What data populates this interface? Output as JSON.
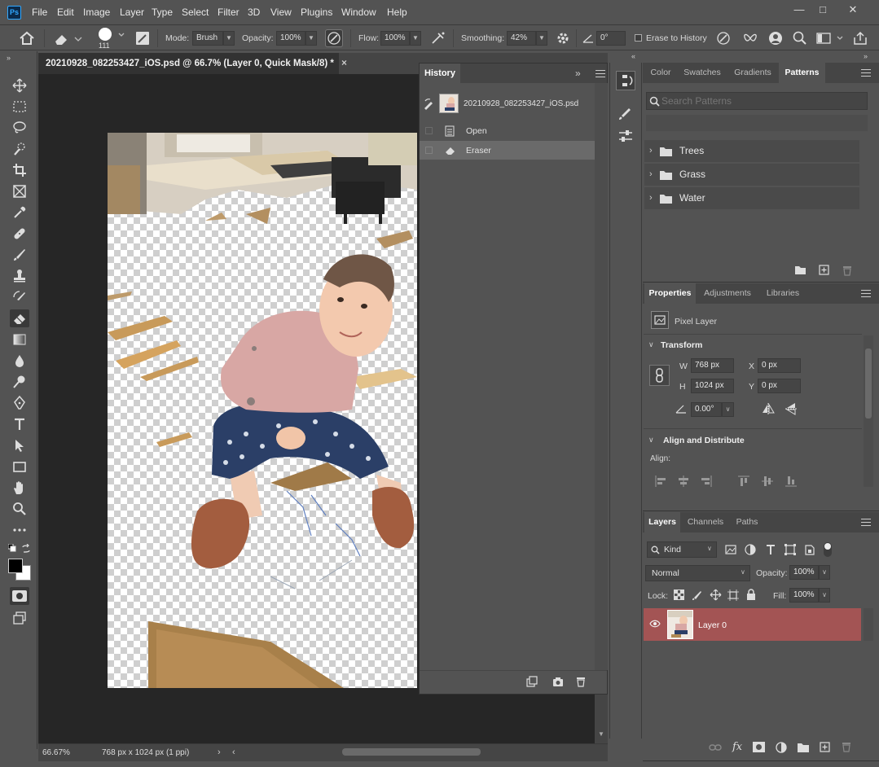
{
  "menu": {
    "app_badge": "Ps",
    "items": [
      "File",
      "Edit",
      "Image",
      "Layer",
      "Type",
      "Select",
      "Filter",
      "3D",
      "View",
      "Plugins",
      "Window",
      "Help"
    ]
  },
  "options": {
    "brush_size": "111",
    "mode_label": "Mode:",
    "mode_value": "Brush",
    "opacity_label": "Opacity:",
    "opacity_value": "100%",
    "flow_label": "Flow:",
    "flow_value": "100%",
    "smoothing_label": "Smoothing:",
    "smoothing_value": "42%",
    "angle_value": "0°",
    "erase_history_label": "Erase to History"
  },
  "document": {
    "tab_title": "20210928_082253427_iOS.psd @ 66.7% (Layer 0, Quick Mask/8) *",
    "zoom": "66.67%",
    "dimensions": "768 px x 1024 px (1 ppi)"
  },
  "history": {
    "tab": "History",
    "snapshot_name": "20210928_082253427_iOS.psd",
    "states": [
      "Open",
      "Eraser"
    ]
  },
  "patterns_panel": {
    "tabs": [
      "Color",
      "Swatches",
      "Gradients",
      "Patterns"
    ],
    "search_placeholder": "Search Patterns",
    "folders": [
      "Trees",
      "Grass",
      "Water"
    ]
  },
  "properties_panel": {
    "tabs": [
      "Properties",
      "Adjustments",
      "Libraries"
    ],
    "layer_type": "Pixel Layer",
    "transform_title": "Transform",
    "w_label": "W",
    "w_value": "768 px",
    "h_label": "H",
    "h_value": "1024 px",
    "x_label": "X",
    "x_value": "0 px",
    "y_label": "Y",
    "y_value": "0 px",
    "angle_value": "0.00°",
    "align_title": "Align and Distribute",
    "align_label": "Align:"
  },
  "layers_panel": {
    "tabs": [
      "Layers",
      "Channels",
      "Paths"
    ],
    "filter_kind": "Kind",
    "blend_mode": "Normal",
    "opacity_label": "Opacity:",
    "opacity_value": "100%",
    "lock_label": "Lock:",
    "fill_label": "Fill:",
    "fill_value": "100%",
    "layers": [
      {
        "name": "Layer 0",
        "visible": true,
        "selected": true
      }
    ]
  },
  "colors": {
    "panel_bg": "#535353",
    "canvas_bg": "#262626",
    "selected_layer": "#a35454",
    "ps_blue": "#31a8ff"
  }
}
